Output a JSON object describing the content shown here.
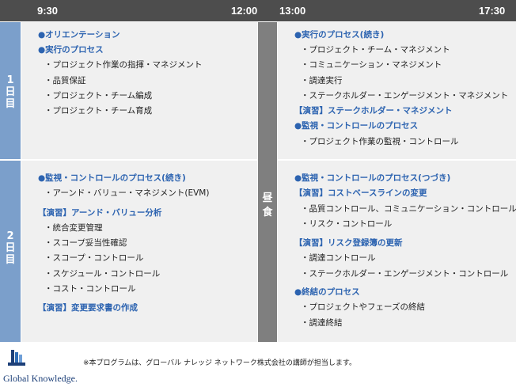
{
  "header": {
    "t1": "9:30",
    "t2": "12:00",
    "t3": "13:00",
    "t4": "17:30"
  },
  "day1": {
    "label": [
      "1",
      "日",
      "目"
    ]
  },
  "day2": {
    "label": [
      "2",
      "日",
      "目"
    ]
  },
  "lunch": {
    "label": [
      "昼",
      "食"
    ]
  },
  "d1am": [
    {
      "t": "●オリエンテーション",
      "k": "h"
    },
    {
      "t": "●実行のプロセス",
      "k": "h"
    },
    {
      "t": "・プロジェクト作業の指揮・マネジメント",
      "k": "s"
    },
    {
      "t": "・品質保証",
      "k": "s"
    },
    {
      "t": "・プロジェクト・チーム編成",
      "k": "s"
    },
    {
      "t": "・プロジェクト・チーム育成",
      "k": "s"
    }
  ],
  "d1pm": [
    {
      "t": "●実行のプロセス(続き)",
      "k": "h"
    },
    {
      "t": "・プロジェクト・チーム・マネジメント",
      "k": "s"
    },
    {
      "t": "・コミュニケーション・マネジメント",
      "k": "s"
    },
    {
      "t": "・調達実行",
      "k": "s"
    },
    {
      "t": "・ステークホルダー・エンゲージメント・マネジメント",
      "k": "s"
    },
    {
      "t": "【演習】ステークホルダー・マネジメント",
      "k": "h"
    },
    {
      "t": "●監視・コントロールのプロセス",
      "k": "h"
    },
    {
      "t": "・プロジェクト作業の監視・コントロール",
      "k": "s"
    }
  ],
  "d2am": [
    {
      "t": "●監視・コントロールのプロセス(続き)",
      "k": "h"
    },
    {
      "t": "・アーンド・バリュー・マネジメント(EVM)",
      "k": "s"
    },
    {
      "t": "【演習】アーンド・バリュー分析",
      "k": "h"
    },
    {
      "t": "・統合変更管理",
      "k": "s"
    },
    {
      "t": "・スコープ妥当性確認",
      "k": "s"
    },
    {
      "t": "・スコープ・コントロール",
      "k": "s"
    },
    {
      "t": "・スケジュール・コントロール",
      "k": "s"
    },
    {
      "t": "・コスト・コントロール",
      "k": "s"
    },
    {
      "t": "【演習】変更要求書の作成",
      "k": "h"
    }
  ],
  "d2pm": [
    {
      "t": "●監視・コントロールのプロセス(つづき)",
      "k": "h"
    },
    {
      "t": "【演習】コストベースラインの変更",
      "k": "h"
    },
    {
      "t": "・品質コントロール、コミュニケーション・コントロール",
      "k": "s"
    },
    {
      "t": "・リスク・コントロール",
      "k": "s"
    },
    {
      "t": "【演習】リスク登録簿の更新",
      "k": "h"
    },
    {
      "t": "・調達コントロール",
      "k": "s"
    },
    {
      "t": "・ステークホルダー・エンゲージメント・コントロール",
      "k": "s"
    },
    {
      "t": "●終結のプロセス",
      "k": "h"
    },
    {
      "t": "・プロジェクトやフェーズの終結",
      "k": "s"
    },
    {
      "t": "・調達終結",
      "k": "s"
    }
  ],
  "footer": {
    "note": "※本プログラムは、グローバル ナレッジ ネットワーク株式会社の講師が担当します。",
    "logo_text": "Global Knowledge."
  }
}
